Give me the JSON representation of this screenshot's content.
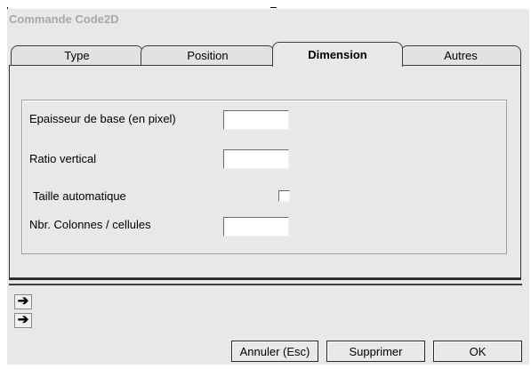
{
  "window": {
    "title": "Commande Code2D"
  },
  "tabs": [
    {
      "label": "Type",
      "active": false
    },
    {
      "label": "Position",
      "active": false
    },
    {
      "label": "Dimension",
      "active": true
    },
    {
      "label": "Autres",
      "active": false
    }
  ],
  "form": {
    "base_thickness_label": "Epaisseur de base (en pixel)",
    "base_thickness_value": "",
    "ratio_label": "Ratio vertical",
    "ratio_value": "",
    "auto_size_label": "Taille automatique",
    "auto_size_checked": false,
    "columns_label": "Nbr. Colonnes / cellules",
    "columns_value": ""
  },
  "arrows": [
    {
      "icon": "right-arrow-icon",
      "glyph": "➔",
      "label": ""
    },
    {
      "icon": "right-arrow-icon",
      "glyph": "➔",
      "label": ""
    }
  ],
  "buttons": {
    "cancel": "Annuler (Esc)",
    "delete": "Supprimer",
    "ok": "OK"
  },
  "colors": {
    "dialog_bg": "#e8e8e8",
    "border": "#3c3c3c",
    "title_text": "#a8a8a8"
  }
}
